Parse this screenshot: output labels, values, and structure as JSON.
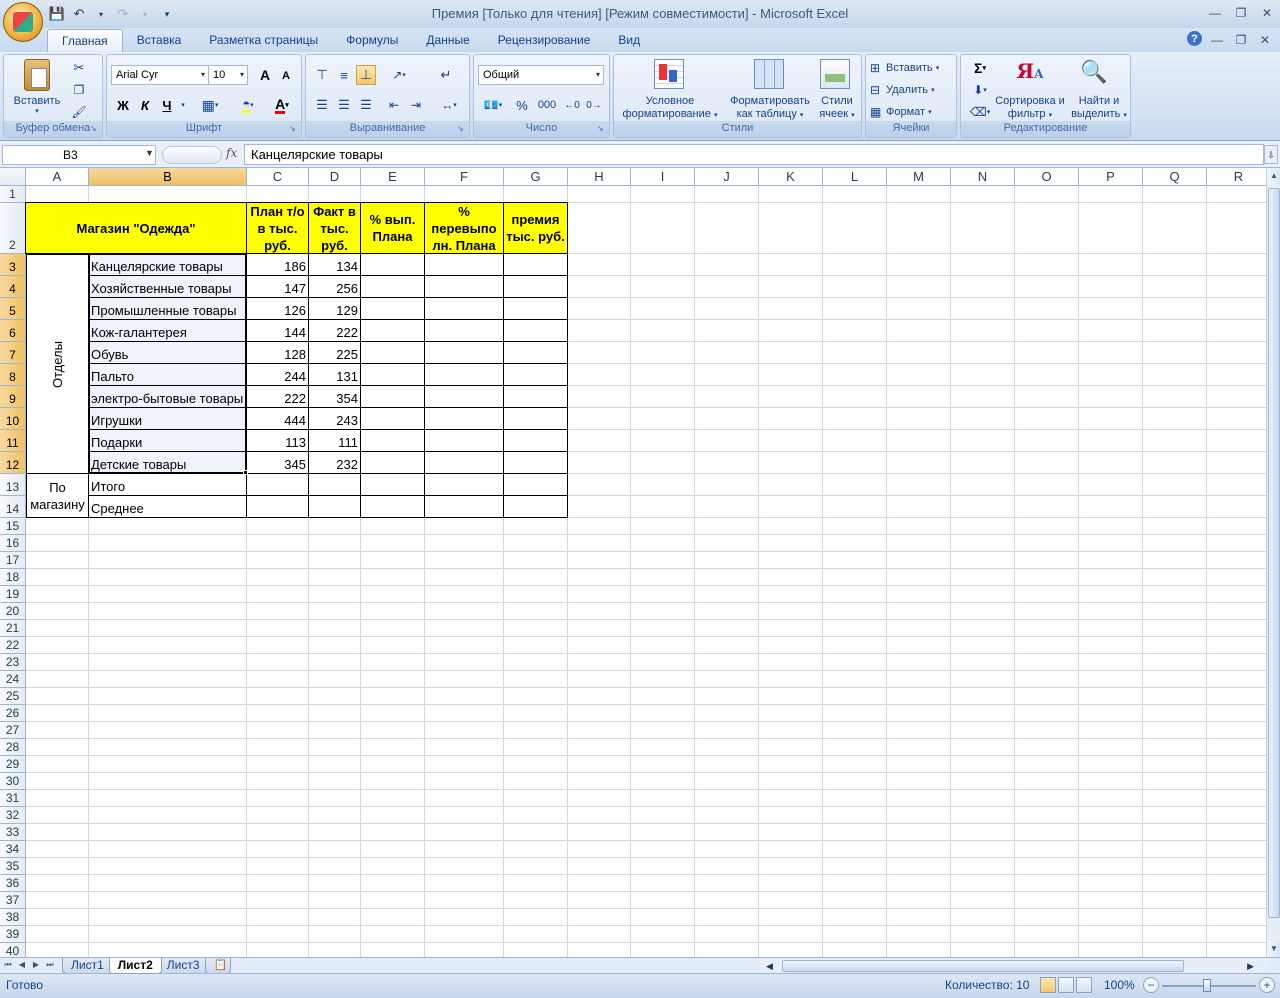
{
  "window": {
    "title": "Премия  [Только для чтения]  [Режим совместимости] - Microsoft Excel"
  },
  "ribbon_tabs": [
    "Главная",
    "Вставка",
    "Разметка страницы",
    "Формулы",
    "Данные",
    "Рецензирование",
    "Вид"
  ],
  "ribbon": {
    "clipboard": {
      "label": "Буфер обмена",
      "paste": "Вставить"
    },
    "font": {
      "label": "Шрифт",
      "name": "Arial Cyr",
      "size": "10",
      "bold": "Ж",
      "italic": "К",
      "underline": "Ч",
      "grow": "A",
      "shrink": "A"
    },
    "alignment": {
      "label": "Выравнивание"
    },
    "number": {
      "label": "Число",
      "format": "Общий",
      "percent": "%",
      "thousands": "000"
    },
    "styles": {
      "label": "Стили",
      "conditional": "Условное форматирование",
      "as_table": "Форматировать как таблицу",
      "cell_styles": "Стили ячеек"
    },
    "cells": {
      "label": "Ячейки",
      "insert": "Вставить",
      "delete": "Удалить",
      "format": "Формат"
    },
    "editing": {
      "label": "Редактирование",
      "sort": "Сортировка и фильтр",
      "find": "Найти и выделить",
      "sum": "Σ"
    }
  },
  "formula_bar": {
    "name_box": "B3",
    "fx": "fx",
    "value": "Канцелярские товары"
  },
  "columns": [
    "A",
    "B",
    "C",
    "D",
    "E",
    "F",
    "G",
    "H",
    "I",
    "J",
    "K",
    "L",
    "M",
    "N",
    "O",
    "P",
    "Q",
    "R"
  ],
  "rows": [
    "1",
    "2",
    "3",
    "4",
    "5",
    "6",
    "7",
    "8",
    "9",
    "10",
    "11",
    "12",
    "13",
    "14",
    "15",
    "16",
    "17",
    "18",
    "19",
    "20",
    "21",
    "22",
    "23",
    "24",
    "25",
    "26",
    "27",
    "28",
    "29",
    "30",
    "31",
    "32",
    "33",
    "34",
    "35",
    "36",
    "37",
    "38",
    "39",
    "40"
  ],
  "sheet": {
    "header_title": "Магазин \"Одежда\"",
    "header_plan": "План т/о в тыс. руб.",
    "header_fact": "Факт в тыс. руб.",
    "header_pct": "% вып. Плана",
    "header_over": "% перевыпо лн. Плана",
    "header_bonus": "премия тыс. руб.",
    "departments_label": "Отделы",
    "store_label": "По магазину",
    "items": [
      {
        "name": "Канцелярские товары",
        "plan": "186",
        "fact": "134"
      },
      {
        "name": "Хозяйственные товары",
        "plan": "147",
        "fact": "256"
      },
      {
        "name": "Промышленные товары",
        "plan": "126",
        "fact": "129"
      },
      {
        "name": "Кож-галантерея",
        "plan": "144",
        "fact": "222"
      },
      {
        "name": "Обувь",
        "plan": "128",
        "fact": "225"
      },
      {
        "name": "Пальто",
        "plan": "244",
        "fact": "131"
      },
      {
        "name": "электро-бытовые товары",
        "plan": "222",
        "fact": "354"
      },
      {
        "name": "Игрушки",
        "plan": "444",
        "fact": "243"
      },
      {
        "name": "Подарки",
        "plan": "113",
        "fact": "111"
      },
      {
        "name": "Детские товары",
        "plan": "345",
        "fact": "232"
      }
    ],
    "total_label": "Итого",
    "avg_label": "Среднее"
  },
  "sheet_tabs": [
    "Лист1",
    "Лист2",
    "Лист3"
  ],
  "active_sheet": "Лист2",
  "status": {
    "ready": "Готово",
    "count": "Количество: 10",
    "zoom": "100%"
  },
  "colors": {
    "header_fill": "#ffff00",
    "selected_header": "#f1c15f"
  }
}
